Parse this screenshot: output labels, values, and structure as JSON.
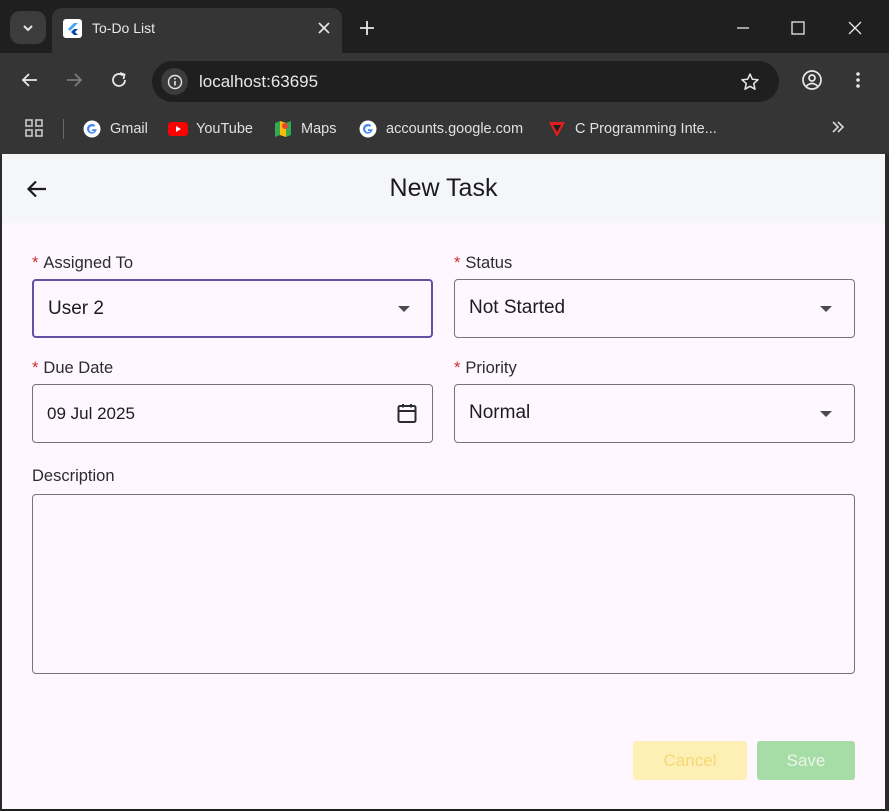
{
  "browser": {
    "tab_title": "To-Do List",
    "url": "localhost:63695",
    "bookmarks": [
      {
        "label": "Gmail",
        "icon": "google-icon"
      },
      {
        "label": "YouTube",
        "icon": "youtube-icon"
      },
      {
        "label": "Maps",
        "icon": "maps-icon"
      },
      {
        "label": "accounts.google.com",
        "icon": "google-icon"
      },
      {
        "label": "C Programming Inte...",
        "icon": "tutorial-icon"
      }
    ]
  },
  "app": {
    "title": "New Task",
    "required_marker": "*",
    "fields": {
      "assigned_to": {
        "label": "Assigned To",
        "value": "User 2"
      },
      "status": {
        "label": "Status",
        "value": "Not Started"
      },
      "due_date": {
        "label": "Due Date",
        "value": "09 Jul 2025"
      },
      "priority": {
        "label": "Priority",
        "value": "Normal"
      },
      "description": {
        "label": "Description",
        "value": ""
      }
    },
    "buttons": {
      "cancel": "Cancel",
      "save": "Save"
    }
  },
  "colors": {
    "accent": "#6750a4",
    "required": "#d32f2f",
    "cancel_bg": "#fef0b4",
    "save_bg": "#a6dca6",
    "app_bg": "#fef7ff"
  }
}
